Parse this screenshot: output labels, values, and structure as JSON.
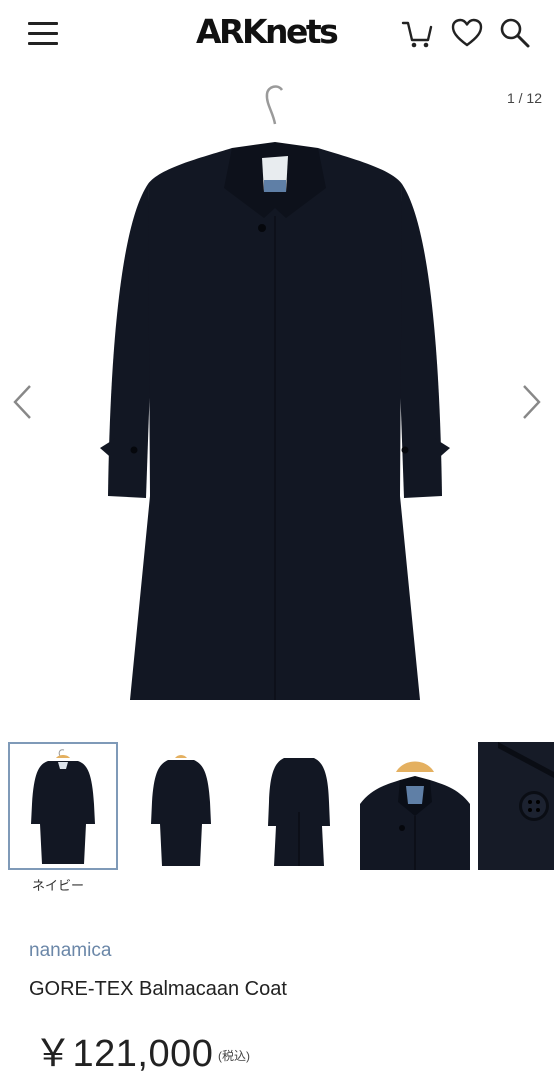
{
  "header": {
    "logo": "ARKnets",
    "icons": [
      "menu-icon",
      "cart-icon",
      "heart-icon",
      "search-icon"
    ]
  },
  "gallery": {
    "counter": "1 / 12",
    "main_image": "navy-balmacaan-coat-on-hanger",
    "prev_icon": "chevron-left-icon",
    "next_icon": "chevron-right-icon"
  },
  "thumbnails": {
    "items": [
      "coat-front-hanger",
      "coat-front",
      "coat-back",
      "collar-closeup",
      "button-closeup"
    ],
    "selected_caption": "ネイビー"
  },
  "product": {
    "brand": "nanamica",
    "title": "GORE-TEX Balmacaan Coat",
    "price": "￥121,000",
    "tax_note": "(税込)"
  },
  "colors": {
    "coat": "#121723",
    "brand_link": "#6b87a8",
    "thumb_border": "#7f9ab8"
  }
}
